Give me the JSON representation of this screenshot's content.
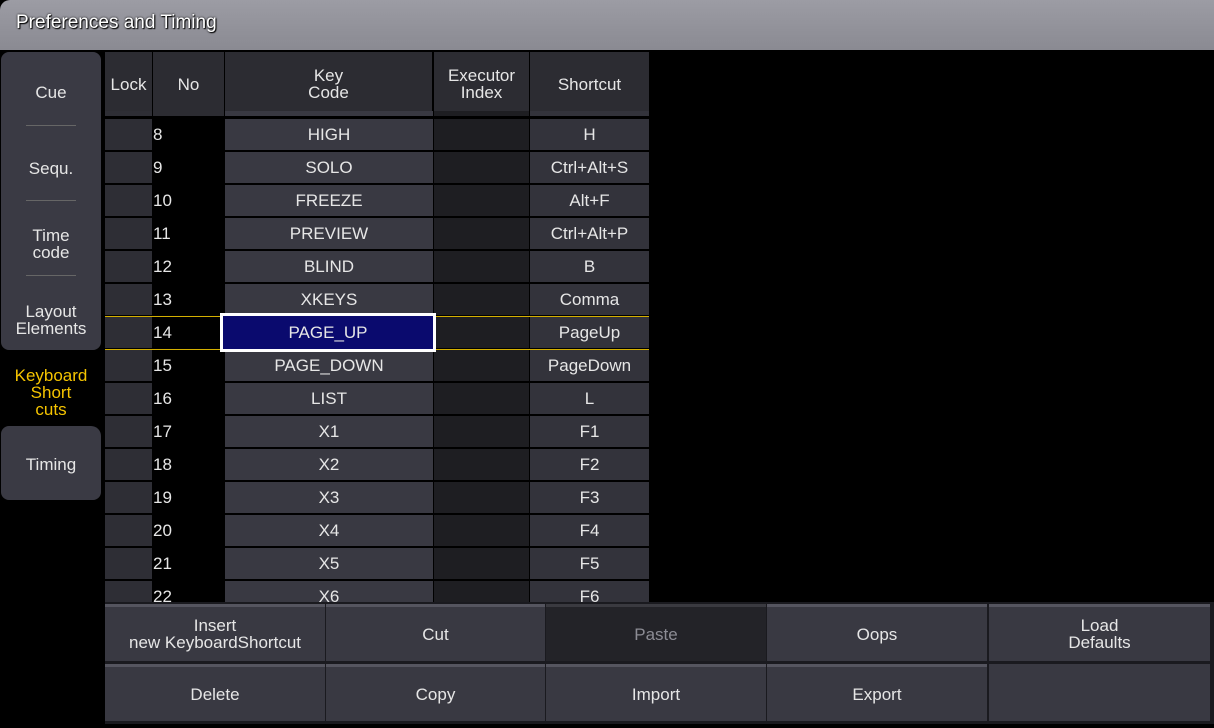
{
  "window": {
    "title": "Preferences and Timing"
  },
  "sidebar": {
    "tabs": [
      {
        "label": "Cue"
      },
      {
        "label": "Sequ."
      },
      {
        "label": "Time\ncode"
      },
      {
        "label": "Layout\nElements"
      },
      {
        "label": "Keyboard\nShort\ncuts",
        "active": true
      },
      {
        "label": "Timing"
      }
    ]
  },
  "table": {
    "headers": {
      "lock": "Lock",
      "no": "No",
      "key_code": "Key\nCode",
      "executor_index": "Executor\nIndex",
      "shortcut": "Shortcut"
    },
    "rows": [
      {
        "no": "8",
        "key": "HIGH",
        "shortcut": "H"
      },
      {
        "no": "9",
        "key": "SOLO",
        "shortcut": "Ctrl+Alt+S"
      },
      {
        "no": "10",
        "key": "FREEZE",
        "shortcut": "Alt+F"
      },
      {
        "no": "11",
        "key": "PREVIEW",
        "shortcut": "Ctrl+Alt+P"
      },
      {
        "no": "12",
        "key": "BLIND",
        "shortcut": "B"
      },
      {
        "no": "13",
        "key": "XKEYS",
        "shortcut": "Comma"
      },
      {
        "no": "14",
        "key": "PAGE_UP",
        "shortcut": "PageUp",
        "selected": true
      },
      {
        "no": "15",
        "key": "PAGE_DOWN",
        "shortcut": "PageDown"
      },
      {
        "no": "16",
        "key": "LIST",
        "shortcut": "L"
      },
      {
        "no": "17",
        "key": "X1",
        "shortcut": "F1"
      },
      {
        "no": "18",
        "key": "X2",
        "shortcut": "F2"
      },
      {
        "no": "19",
        "key": "X3",
        "shortcut": "F3"
      },
      {
        "no": "20",
        "key": "X4",
        "shortcut": "F4"
      },
      {
        "no": "21",
        "key": "X5",
        "shortcut": "F5"
      },
      {
        "no": "22",
        "key": "X6",
        "shortcut": "F6"
      }
    ]
  },
  "buttons": {
    "insert": "Insert\nnew KeyboardShortcut",
    "cut": "Cut",
    "paste": "Paste",
    "oops": "Oops",
    "load_defaults": "Load\nDefaults",
    "delete": "Delete",
    "copy": "Copy",
    "import": "Import",
    "export": "Export"
  },
  "colors": {
    "accent": "#f5c400",
    "selection": "#0a0a6e"
  }
}
